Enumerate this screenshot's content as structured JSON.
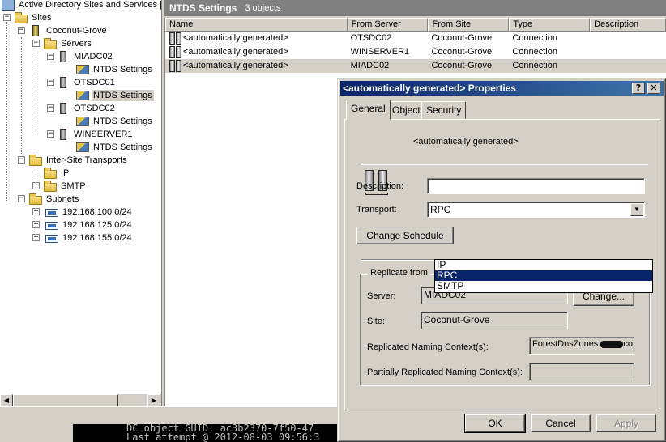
{
  "tree": {
    "root": "Active Directory Sites and Services [c",
    "sites": "Sites",
    "site_name": "Coconut-Grove",
    "servers": "Servers",
    "server_nodes": [
      {
        "name": "MIADC02",
        "child": "NTDS Settings"
      },
      {
        "name": "OTSDC01",
        "child": "NTDS Settings"
      },
      {
        "name": "OTSDC02",
        "child": "NTDS Settings"
      },
      {
        "name": "WINSERVER1",
        "child": "NTDS Settings"
      }
    ],
    "transports": "Inter-Site Transports",
    "transport_items": [
      "IP",
      "SMTP"
    ],
    "subnets": "Subnets",
    "subnet_items": [
      "192.168.100.0/24",
      "192.168.125.0/24",
      "192.168.155.0/24"
    ]
  },
  "list": {
    "title": "NTDS Settings",
    "count": "3 objects",
    "columns": [
      "Name",
      "From Server",
      "From Site",
      "Type",
      "Description"
    ],
    "rows": [
      {
        "name": "<automatically generated>",
        "from_server": "OTSDC02",
        "from_site": "Coconut-Grove",
        "type": "Connection",
        "description": ""
      },
      {
        "name": "<automatically generated>",
        "from_server": "WINSERVER1",
        "from_site": "Coconut-Grove",
        "type": "Connection",
        "description": ""
      },
      {
        "name": "<automatically generated>",
        "from_server": "MIADC02",
        "from_site": "Coconut-Grove",
        "type": "Connection",
        "description": ""
      }
    ]
  },
  "console": {
    "line1": "DC object GUID: ac3b2370-7f50-47",
    "line2": "Last attempt @ 2012-08-03 09:56:3"
  },
  "dialog": {
    "title": "<automatically generated> Properties",
    "help_glyph": "?",
    "close_glyph": "✕",
    "tabs": [
      "General",
      "Object",
      "Security"
    ],
    "object_name": "<automatically generated>",
    "description_label": "Description:",
    "description_value": "",
    "transport_label": "Transport:",
    "transport_value": "RPC",
    "transport_options": [
      "IP",
      "RPC",
      "SMTP"
    ],
    "change_schedule": "Change Schedule",
    "replicate_from": "Replicate from",
    "server_label": "Server:",
    "server_value": "MIADC02",
    "change_button": "Change...",
    "site_label": "Site:",
    "site_value": "Coconut-Grove",
    "rnc_label": "Replicated Naming Context(s):",
    "rnc_value_prefix": "ForestDnsZones.",
    "rnc_value_suffix": "co",
    "prnc_label": "Partially Replicated Naming Context(s):",
    "prnc_value": "",
    "ok": "OK",
    "cancel": "Cancel",
    "apply": "Apply"
  }
}
